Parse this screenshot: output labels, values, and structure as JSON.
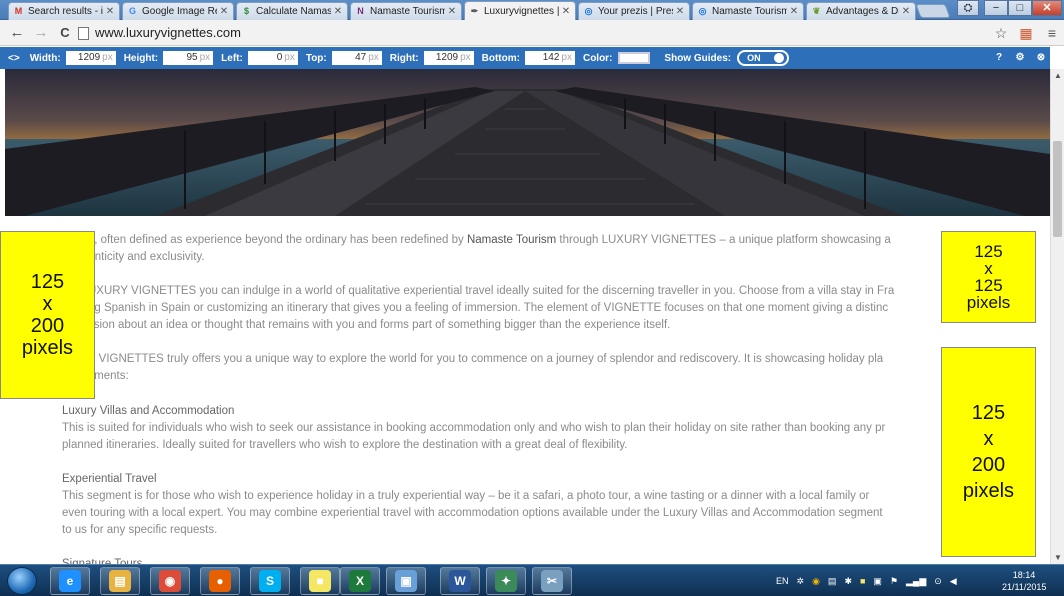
{
  "tabs": [
    {
      "label": "Search results - in",
      "icon": "gmail-icon",
      "icon_glyph": "M",
      "icon_color": "#d93025"
    },
    {
      "label": "Google Image Re",
      "icon": "google-icon",
      "icon_glyph": "G",
      "icon_color": "#4285f4"
    },
    {
      "label": "Calculate Namast",
      "icon": "dollar-icon",
      "icon_glyph": "$",
      "icon_color": "#2e8b2e"
    },
    {
      "label": "Namaste Tourism",
      "icon": "namaste-logo-icon",
      "icon_glyph": "N",
      "icon_color": "#7a2f7a"
    },
    {
      "label": "Luxuryvignettes |",
      "icon": "page-logo-icon",
      "icon_glyph": "✒",
      "icon_color": "#555555"
    },
    {
      "label": "Your prezis | Pres",
      "icon": "prezi-icon",
      "icon_glyph": "◎",
      "icon_color": "#1a73e8"
    },
    {
      "label": "Namaste Tourism",
      "icon": "prezi-icon",
      "icon_glyph": "◎",
      "icon_color": "#1a73e8"
    },
    {
      "label": "Advantages & Di",
      "icon": "leaf-icon",
      "icon_glyph": "❦",
      "icon_color": "#6a9a2a"
    }
  ],
  "active_tab": 4,
  "window_controls": {
    "min": "−",
    "max": "□",
    "close": "✕"
  },
  "address": {
    "url": "www.luxuryvignettes.com",
    "back": "←",
    "forward": "→",
    "reload": "C",
    "star": "☆",
    "menu": "≡"
  },
  "guides": {
    "toggle_glyph": "<>",
    "width_label": "Width:",
    "width_value": "1209",
    "height_label": "Height:",
    "height_value": "95",
    "left_label": "Left:",
    "left_value": "0",
    "top_label": "Top:",
    "top_value": "47",
    "right_label": "Right:",
    "right_value": "1209",
    "bottom_label": "Bottom:",
    "bottom_value": "142",
    "unit": "px",
    "color_label": "Color:",
    "show_guides_label": "Show Guides:",
    "switch_state": "ON",
    "help": "?",
    "settings": "⚙",
    "close": "⊗"
  },
  "content": {
    "para1_line1": "Y, often defined as experience beyond the ordinary has been redefined by",
    "para1_brand": "Namaste Tourism",
    "para1_line1b": "through LUXURY VIGNETTES – a unique platform showcasing a",
    "para1_line2": "authenticity and exclusivity.",
    "para2_line1": "UXURY VIGNETTES you can indulge in a world of qualitative experiential travel ideally suited for the discerning traveller in you. Choose from a villa stay in Fra",
    "para2_line2": "ng Spanish in Spain or   customizing an itinerary that gives you a feeling of immersion. The element of VIGNETTE focuses on that one moment giving a distinc",
    "para2_line3": "ssion about an idea or thought that remains with you and forms part of something bigger than the experience itself.",
    "para3_line1": "Y VIGNETTES truly offers you a unique way to explore the world for you to commence on a journey of splendor and rediscovery. It is showcasing holiday pla",
    "para3_line2": "3 segments:",
    "section1_heading": "Luxury Villas and Accommodation",
    "section1_line1": "This is suited for individuals who wish to seek our assistance in booking accommodation only and who wish to plan their holiday on site rather than booking any pr",
    "section1_line2": "planned itineraries. Ideally suited for travellers who wish to explore the destination with a great deal of flexibility.",
    "section2_heading": "Experiential Travel",
    "section2_line1": "This segment is for those who wish to experience holiday in a truly experiential way – be it a safari, a photo tour, a wine tasting or a dinner with a local family or",
    "section2_line2": "even touring with a local expert. You may combine experiential travel with accommodation options available under the Luxury Villas and Accommodation segment",
    "section2_line3": "to us for any specific requests.",
    "section3_heading_partial": "Signature Tours"
  },
  "stickies": {
    "left": {
      "line1": "125",
      "line2": "x",
      "line3": "200",
      "line4": "pixels"
    },
    "right_top": {
      "line1": "125",
      "line2": "x",
      "line3": "125",
      "line4": "pixels"
    },
    "right_bottom": {
      "line1": "125",
      "line2": "x",
      "line3": "200",
      "line4": "pixels"
    }
  },
  "taskbar": {
    "apps": [
      {
        "name": "ie-icon",
        "glyph": "e",
        "color": "#1e90ff"
      },
      {
        "name": "explorer-folder-icon",
        "glyph": "▤",
        "color": "#e8b340"
      },
      {
        "name": "chrome-icon",
        "glyph": "◉",
        "color": "#dd4b39"
      },
      {
        "name": "firefox-icon",
        "glyph": "●",
        "color": "#e66000"
      },
      {
        "name": "skype-icon",
        "glyph": "S",
        "color": "#00aff0"
      },
      {
        "name": "sticky-notes-icon",
        "glyph": "■",
        "color": "#f5e663"
      },
      {
        "name": "excel-icon",
        "glyph": "X",
        "color": "#1d7a3b"
      },
      {
        "name": "window-app-icon",
        "glyph": "▣",
        "color": "#6aa0d8"
      },
      {
        "name": "word-icon",
        "glyph": "W",
        "color": "#2b579a"
      },
      {
        "name": "network-app-icon",
        "glyph": "✦",
        "color": "#3b8a5a"
      },
      {
        "name": "snipping-tool-icon",
        "glyph": "✂",
        "color": "#7aa0c0"
      }
    ],
    "language": "EN",
    "time": "18:14",
    "date": "21/11/2015"
  },
  "colors": {
    "toolbar_blue": "#2e6fba",
    "sticky_yellow": "#ffff00",
    "body_text": "#8b8b8b"
  }
}
